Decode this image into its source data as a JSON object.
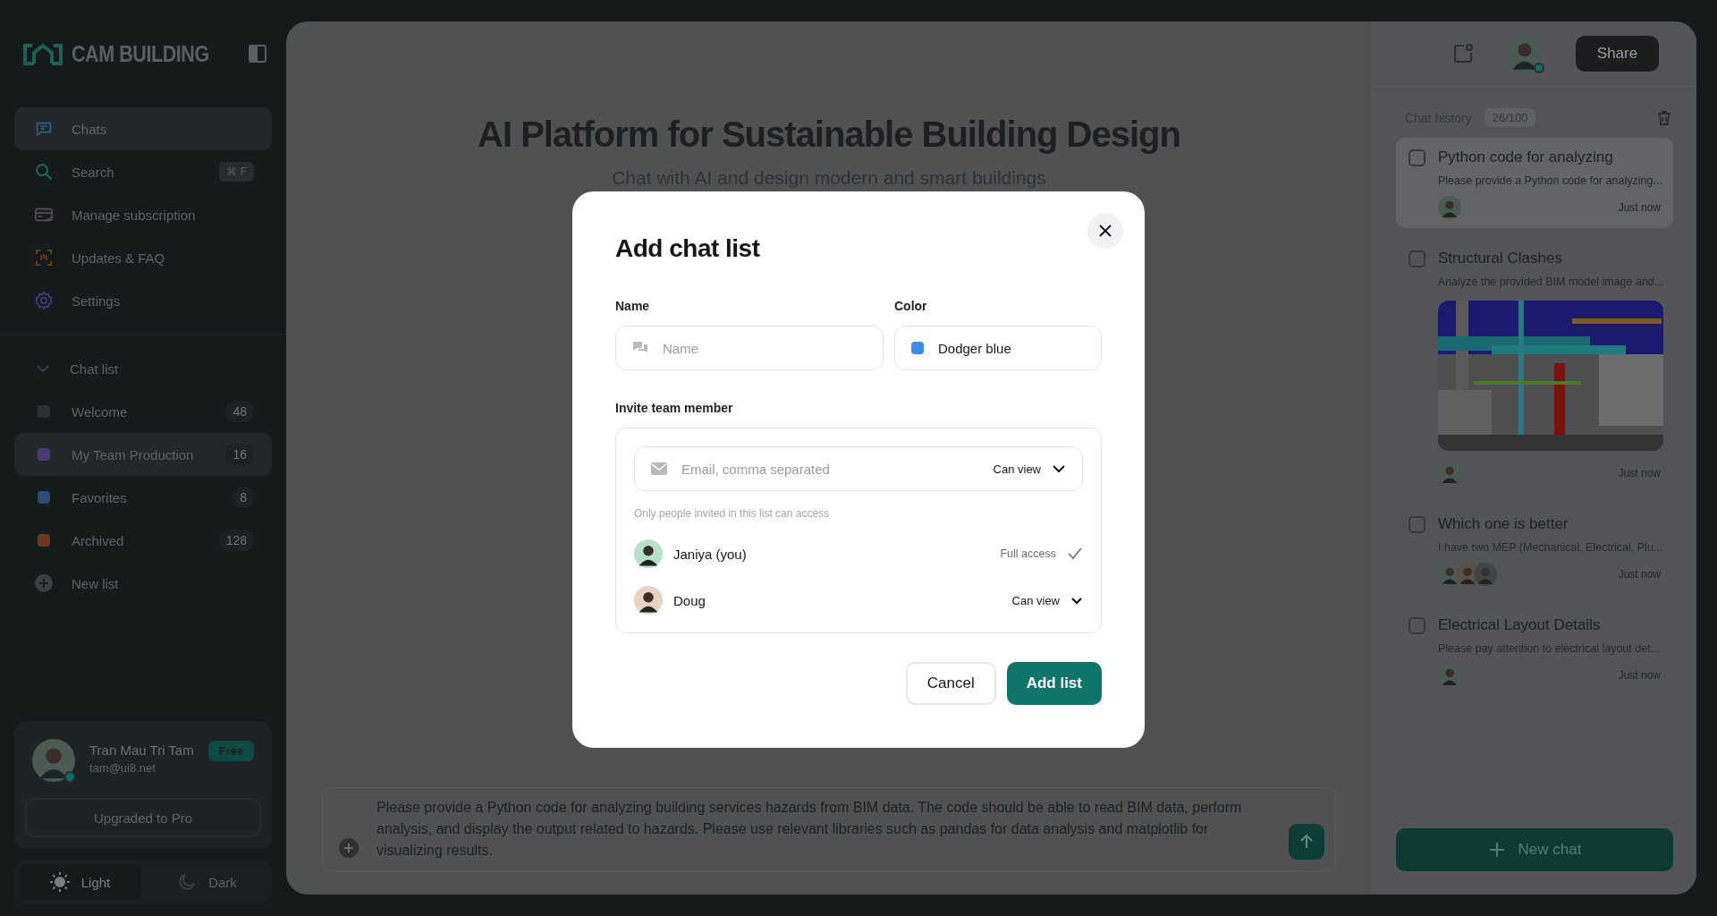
{
  "app": {
    "brand": "CAM BUILDING"
  },
  "nav": [
    {
      "label": "Chats",
      "selected": true
    },
    {
      "label": "Search",
      "selected": false,
      "shortcut": "⌘ F"
    },
    {
      "label": "Manage subscription",
      "selected": false
    },
    {
      "label": "Updates & FAQ",
      "selected": false
    },
    {
      "label": "Settings",
      "selected": false
    }
  ],
  "chat_list": {
    "title": "Chat list",
    "expanded": true,
    "items": [
      {
        "label": "Welcome",
        "count": "48",
        "color": "#2b3033",
        "selected": false
      },
      {
        "label": "My Team Production",
        "count": "16",
        "color": "#4b3a72",
        "selected": true
      },
      {
        "label": "Favorites",
        "count": "8",
        "color": "#2c4b70",
        "selected": false
      },
      {
        "label": "Archived",
        "count": "128",
        "color": "#6b3920",
        "selected": false
      }
    ],
    "new_list": "New list"
  },
  "profile": {
    "name": "Tran Mau Tri Tam",
    "email": "tam@ui8.net",
    "plan": "Free",
    "online": true,
    "upgrade": "Upgraded to Pro"
  },
  "theme": [
    {
      "label": "Light",
      "kind": "sun",
      "selected": true
    },
    {
      "label": "Dark",
      "kind": "moon",
      "selected": false
    }
  ],
  "main": {
    "title": "AI Platform for Sustainable Building Design",
    "subtitle": "Chat with AI and design modern and smart buildings",
    "prompt": "Please provide a Python code for analyzing building services hazards from BIM data. The code should be able to read BIM data, perform analysis, and display the output related to hazards. Please use relevant libraries such as pandas for data analysis and matplotlib for visualizing results."
  },
  "topbar": {
    "online": true,
    "share": "Share"
  },
  "history": {
    "title": "Chat history",
    "count": "26/100",
    "items": [
      {
        "title": "Python code for analyzing",
        "preview": "Please provide a Python code for analyzing...",
        "time": "Just now",
        "selected": true,
        "checked": false
      },
      {
        "title": "Structural Clashes",
        "preview": "Analyze the provided BIM model image and...",
        "time": "Just now",
        "selected": false,
        "checked": false
      },
      {
        "title": "Which one is better",
        "preview": "I have two MEP (Mechanical, Electrical, Plu...",
        "time": "Just now",
        "selected": false,
        "checked": false
      },
      {
        "title": "Electrical Layout Details",
        "preview": "Please pay attention to electrical layout det...",
        "time": "Just now",
        "selected": false,
        "checked": false
      }
    ],
    "new_chat": "New chat"
  },
  "modal": {
    "title": "Add chat list",
    "name_label": "Name",
    "name_placeholder": "Name",
    "color_label": "Color",
    "color_value": "Dodger blue",
    "color": "#3b8beb",
    "invite_label": "Invite team member",
    "email_placeholder": "Email, comma separated",
    "email_permission": "Can view",
    "note": "Only people invited in this list can access",
    "members": [
      {
        "name": "Janiya (you)",
        "access": "Full access",
        "kind": "owner"
      },
      {
        "name": "Doug",
        "access": "Can view",
        "kind": "dropdown"
      }
    ],
    "buttons": [
      {
        "label": "Cancel",
        "kind": "secondary"
      },
      {
        "label": "Add list",
        "kind": "primary"
      }
    ]
  }
}
